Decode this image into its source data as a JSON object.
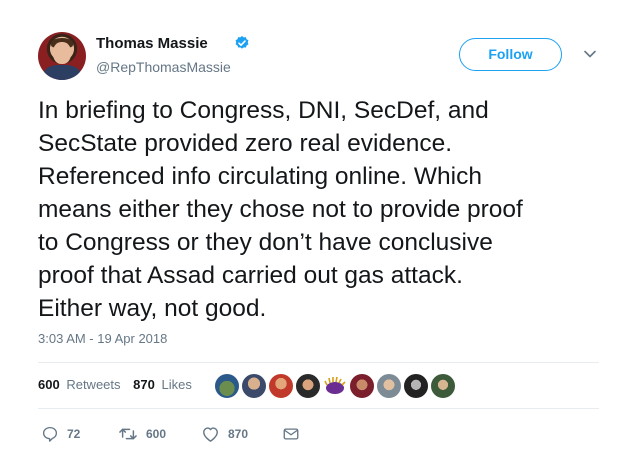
{
  "author": {
    "name": "Thomas Massie",
    "handle": "@RepThomasMassie",
    "verified_icon": "verified-badge-icon"
  },
  "follow": {
    "label": "Follow"
  },
  "tweet": {
    "lines": [
      "In briefing to Congress, DNI, SecDef, and",
      "SecState provided zero real evidence.",
      "Referenced info circulating online. Which",
      "means either they chose not to provide proof",
      "to Congress or they don’t have conclusive",
      "proof that Assad carried out gas attack.",
      "Either way, not good."
    ],
    "timestamp": "3:03 AM - 19 Apr 2018"
  },
  "stats": {
    "retweets_count": "600",
    "retweets_label": "Retweets",
    "likes_count": "870",
    "likes_label": "Likes"
  },
  "actions": {
    "reply_count": "72",
    "retweet_count": "600",
    "like_count": "870"
  },
  "colors": {
    "accent": "#1da1f2",
    "secondary_text": "#657786",
    "divider": "#e6ecf0"
  }
}
